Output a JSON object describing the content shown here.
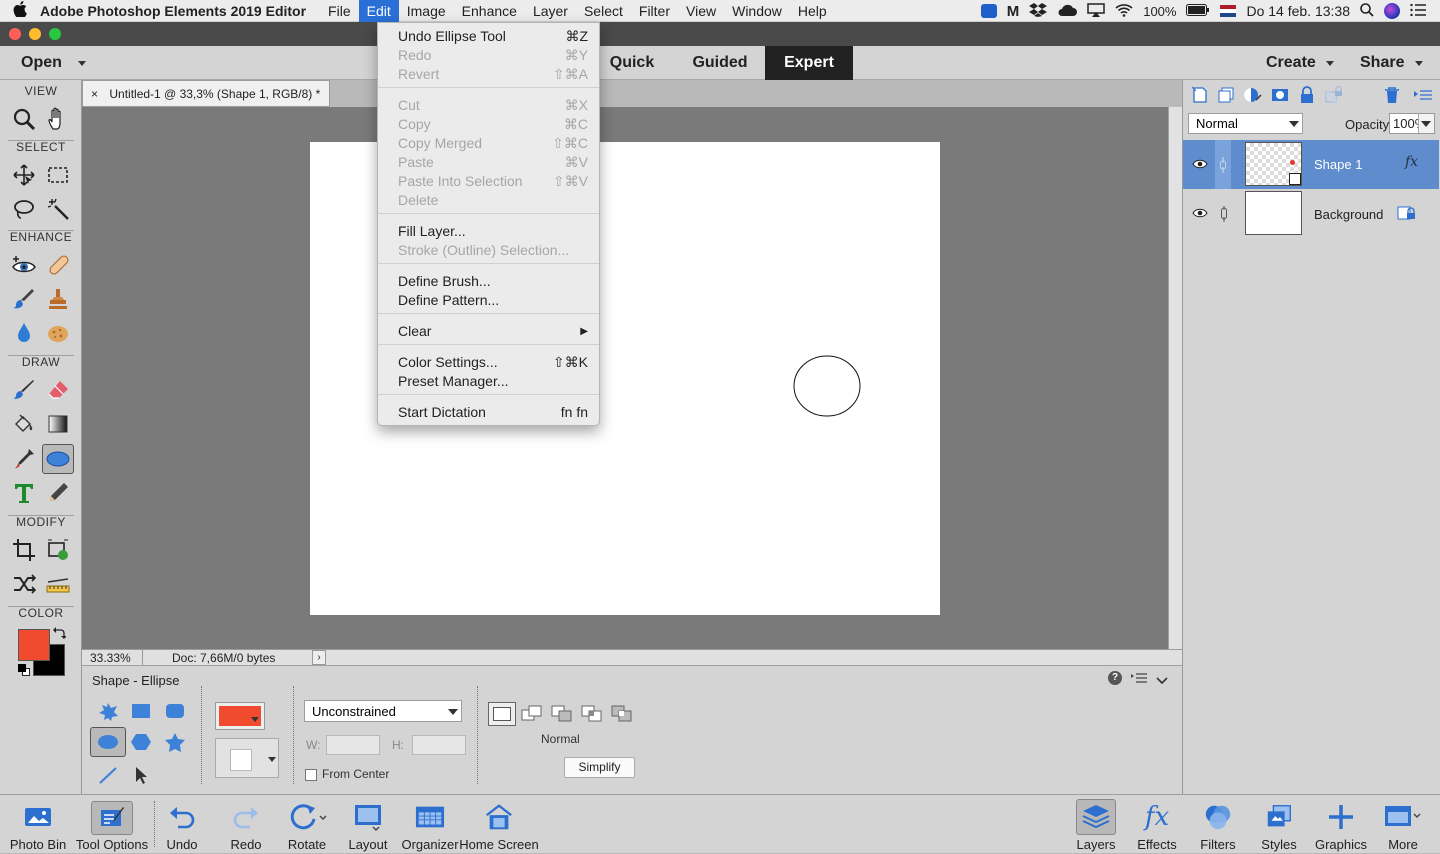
{
  "menubar": {
    "app_name": "Adobe Photoshop Elements 2019 Editor",
    "items": [
      "File",
      "Edit",
      "Image",
      "Enhance",
      "Layer",
      "Select",
      "Filter",
      "View",
      "Window",
      "Help"
    ],
    "active_item": "Edit",
    "battery": "100%",
    "datetime": "Do 14 feb.  13:38"
  },
  "topbar": {
    "open_label": "Open",
    "modes": [
      "Quick",
      "Guided",
      "Expert"
    ],
    "active_mode": "Expert",
    "create_label": "Create",
    "share_label": "Share"
  },
  "document": {
    "tab_title": "Untitled-1 @ 33,3% (Shape 1, RGB/8) *",
    "zoom": "33.33%",
    "doc_info": "Doc: 7,66M/0 bytes"
  },
  "toolbox": {
    "sections": {
      "view": "VIEW",
      "select": "SELECT",
      "enhance": "ENHANCE",
      "draw": "DRAW",
      "modify": "MODIFY",
      "color": "COLOR"
    },
    "foreground_color": "#f04a2f",
    "background_color": "#000000"
  },
  "edit_menu": {
    "items": [
      {
        "label": "Undo Ellipse Tool",
        "shortcut": "⌘Z",
        "enabled": true
      },
      {
        "label": "Redo",
        "shortcut": "⌘Y",
        "enabled": false
      },
      {
        "label": "Revert",
        "shortcut": "⇧⌘A",
        "enabled": false
      },
      {
        "label": "Cut",
        "shortcut": "⌘X",
        "enabled": false
      },
      {
        "label": "Copy",
        "shortcut": "⌘C",
        "enabled": false
      },
      {
        "label": "Copy Merged",
        "shortcut": "⇧⌘C",
        "enabled": false
      },
      {
        "label": "Paste",
        "shortcut": "⌘V",
        "enabled": false
      },
      {
        "label": "Paste Into Selection",
        "shortcut": "⇧⌘V",
        "enabled": false
      },
      {
        "label": "Delete",
        "shortcut": "",
        "enabled": false
      },
      {
        "label": "Fill Layer...",
        "shortcut": "",
        "enabled": true
      },
      {
        "label": "Stroke (Outline) Selection...",
        "shortcut": "",
        "enabled": false
      },
      {
        "label": "Define Brush...",
        "shortcut": "",
        "enabled": true
      },
      {
        "label": "Define Pattern...",
        "shortcut": "",
        "enabled": true
      },
      {
        "label": "Clear",
        "shortcut": "▶",
        "enabled": true
      },
      {
        "label": "Color Settings...",
        "shortcut": "⇧⌘K",
        "enabled": true
      },
      {
        "label": "Preset Manager...",
        "shortcut": "",
        "enabled": true
      },
      {
        "label": "Start Dictation",
        "shortcut": "fn fn",
        "enabled": true
      }
    ]
  },
  "tool_options": {
    "title": "Shape - Ellipse",
    "shape_color": "#f04a2f",
    "constraint": "Unconstrained",
    "w_label": "W:",
    "h_label": "H:",
    "w_value": "",
    "h_value": "",
    "from_center_label": "From Center",
    "from_center_checked": false,
    "mode_label": "Normal",
    "simplify_label": "Simplify"
  },
  "layers_panel": {
    "blend_mode": "Normal",
    "opacity_label": "Opacity:",
    "opacity_value": "100%",
    "layers": [
      {
        "name": "Shape 1",
        "selected": true
      },
      {
        "name": "Background",
        "selected": false
      }
    ]
  },
  "bottombar": {
    "left": [
      "Photo Bin",
      "Tool Options",
      "Undo",
      "Redo",
      "Rotate",
      "Layout",
      "Organizer",
      "Home Screen"
    ],
    "right": [
      "Layers",
      "Effects",
      "Filters",
      "Styles",
      "Graphics",
      "More"
    ]
  }
}
